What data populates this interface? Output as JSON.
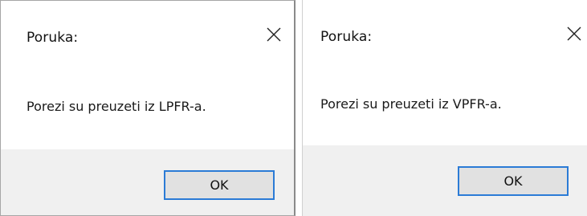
{
  "dialogs": [
    {
      "title": "Poruka:",
      "message": "Porezi su preuzeti iz LPFR-a.",
      "ok_label": "OK",
      "close_icon": "close-icon"
    },
    {
      "title": "Poruka:",
      "message": "Porezi su preuzeti iz VPFR-a.",
      "ok_label": "OK",
      "close_icon": "close-icon"
    }
  ],
  "colors": {
    "footer": "#f0f0f0",
    "button_face": "#e1e1e1",
    "button_focus_border": "#2b7bd6"
  }
}
